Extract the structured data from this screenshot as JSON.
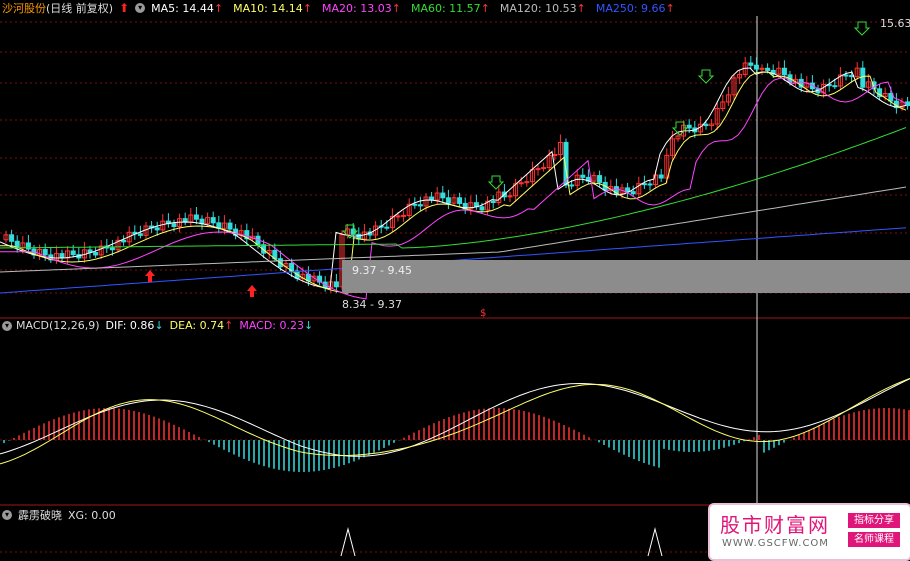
{
  "header": {
    "stock_name": "沙河股份",
    "period": "(日线 前复权)",
    "ma_items": [
      {
        "label": "MA5: 14.44",
        "color": "#ffffff"
      },
      {
        "label": "MA10: 14.14",
        "color": "#ffff66"
      },
      {
        "label": "MA20: 13.03",
        "color": "#ff44ff"
      },
      {
        "label": "MA60: 11.57",
        "color": "#33dd33"
      },
      {
        "label": "MA120: 10.53",
        "color": "#bbbbbb"
      },
      {
        "label": "MA250: 9.66",
        "color": "#3355ff"
      }
    ]
  },
  "price_panel": {
    "high_label": "15.63",
    "low_label": "8.34 - 9.37",
    "range_label": "9.37 - 9.45",
    "marker": "$"
  },
  "macd": {
    "title": "MACD(12,26,9)",
    "dif": "DIF: 0.86",
    "dea": "DEA: 0.74",
    "macd": "MACD: 0.23",
    "colors": {
      "dif": "#ffffff",
      "dea": "#ffff66",
      "macd": "#ff44ff"
    }
  },
  "xg": {
    "title": "霹雳破晓",
    "value": "XG: 0.00"
  },
  "watermark": {
    "main": "股市财富网",
    "url": "WWW.GSCFW.COM",
    "tag1": "指标分享",
    "tag2": "名师课程"
  },
  "colors": {
    "up": "#ff3333",
    "down": "#33dddd",
    "bg": "#000000",
    "grid": "#7a1010"
  }
}
